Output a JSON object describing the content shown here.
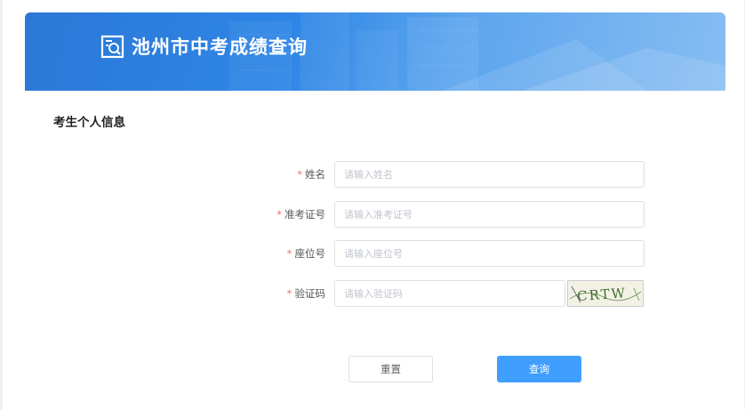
{
  "header": {
    "title": "池州市中考成绩查询",
    "icon": "search-document-icon",
    "colors": {
      "banner_start": "#2b77d6",
      "banner_end": "#88bdf2"
    }
  },
  "section": {
    "title": "考生个人信息"
  },
  "form": {
    "required_mark": "*",
    "fields": [
      {
        "label": "姓名",
        "placeholder": "请输入姓名",
        "value": ""
      },
      {
        "label": "准考证号",
        "placeholder": "请输入准考证号",
        "value": ""
      },
      {
        "label": "座位号",
        "placeholder": "请输入座位号",
        "value": ""
      },
      {
        "label": "验证码",
        "placeholder": "请输入验证码",
        "value": ""
      }
    ],
    "captcha_text": "CRTW"
  },
  "actions": {
    "reset_label": "重置",
    "query_label": "查询",
    "primary_color": "#409eff"
  }
}
